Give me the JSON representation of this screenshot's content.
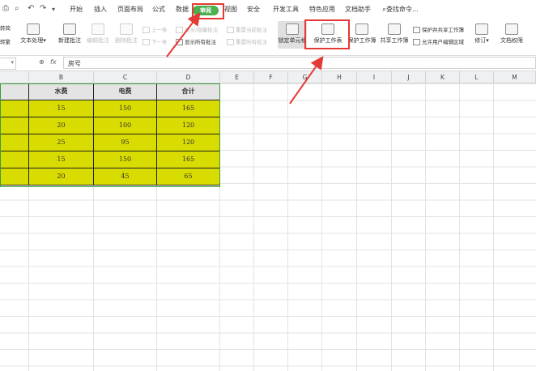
{
  "menu": [
    "开始",
    "插入",
    "页面布局",
    "公式",
    "数据",
    "审阅",
    "视图",
    "安全",
    "开发工具",
    "特色应用",
    "文档助手"
  ],
  "active_tab": "审阅",
  "search_label": "查找命令...",
  "ribbon": {
    "left_partial_1": "转简",
    "left_partial_2": "转繁",
    "text_processing": "文本处理",
    "new_comment": "新建批注",
    "edit_comment": "编辑批注",
    "delete_comment": "删除批注",
    "prev": "上一条",
    "next": "下一条",
    "show_hide_comment": "显示/隐藏批注",
    "show_all_comments": "显示所有批注",
    "reset_current_comment": "重置当前批注",
    "reset_all_comments": "重置所有批注",
    "lock_cell": "锁定单元格",
    "protect_sheet": "保护工作表",
    "protect_workbook": "保护工作簿",
    "share_workbook": "共享工作簿",
    "protect_share_workbook": "保护并共享工作簿",
    "allow_edit_ranges": "允许用户编辑区域",
    "revise": "修订",
    "doc_permission": "文档权限"
  },
  "formula_bar": {
    "name_box": "",
    "fx": "fx",
    "content": "房号"
  },
  "columns": [
    "B",
    "C",
    "D",
    "E",
    "F",
    "G",
    "H",
    "I",
    "J",
    "K",
    "L",
    "M"
  ],
  "table": {
    "headers": [
      "水费",
      "电费",
      "合计"
    ],
    "rows": [
      [
        "15",
        "150",
        "165"
      ],
      [
        "20",
        "100",
        "120"
      ],
      [
        "25",
        "95",
        "120"
      ],
      [
        "15",
        "150",
        "165"
      ],
      [
        "20",
        "45",
        "65"
      ]
    ]
  },
  "colors": {
    "cell_fill": "#d9dc00",
    "active_tab": "#4caf50",
    "annotation": "#e53935"
  }
}
